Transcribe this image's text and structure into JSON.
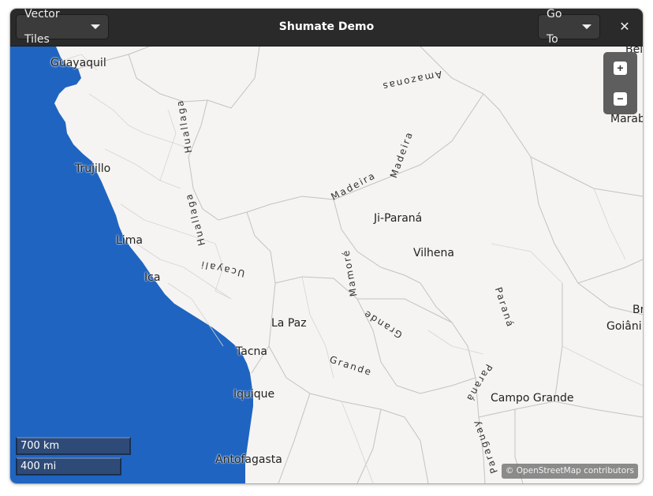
{
  "headerbar": {
    "title": "Shumate Demo",
    "layer_button": "Vector Tiles",
    "goto_button": "Go To",
    "close_glyph": "✕"
  },
  "map": {
    "cities": [
      {
        "id": "guayaquil",
        "name": "Guayaquil"
      },
      {
        "id": "trujillo",
        "name": "Trujillo"
      },
      {
        "id": "lima",
        "name": "Lima"
      },
      {
        "id": "ica",
        "name": "Ica"
      },
      {
        "id": "la-paz",
        "name": "La Paz"
      },
      {
        "id": "tacna",
        "name": "Tacna"
      },
      {
        "id": "iquique",
        "name": "Iquique"
      },
      {
        "id": "antofagasta",
        "name": "Antofagasta"
      },
      {
        "id": "ji-parana",
        "name": "Ji-Paraná"
      },
      {
        "id": "vilhena",
        "name": "Vilhena"
      },
      {
        "id": "campo-grande",
        "name": "Campo Grande"
      },
      {
        "id": "goiania",
        "name": "Goiâni"
      },
      {
        "id": "maraba",
        "name": "Marab"
      },
      {
        "id": "bel",
        "name": "Bel"
      },
      {
        "id": "br",
        "name": "Br"
      }
    ],
    "rivers": [
      {
        "id": "amazonas",
        "name": "Amazonas"
      },
      {
        "id": "madeira-1",
        "name": "Madeira"
      },
      {
        "id": "madeira-2",
        "name": "Madeira"
      },
      {
        "id": "mamore",
        "name": "Mamoré"
      },
      {
        "id": "grande-1",
        "name": "Grande"
      },
      {
        "id": "grande-2",
        "name": "Grande"
      },
      {
        "id": "parana-1",
        "name": "Paraná"
      },
      {
        "id": "parana-2",
        "name": "Paraná"
      },
      {
        "id": "ucayali",
        "name": "Ucayali"
      },
      {
        "id": "huallaga-1",
        "name": "Huallaga"
      },
      {
        "id": "huallaga-2",
        "name": "Huallaga"
      },
      {
        "id": "paraguay",
        "name": "Paraguay"
      }
    ],
    "zoom_in": "+",
    "zoom_out": "−",
    "scale_km": "700 km",
    "scale_mi": "400 mi",
    "attribution": "© OpenStreetMap contributors",
    "colors": {
      "ocean": "#1f64c0",
      "land": "#f5f4f2",
      "borders": "#c4c2bf"
    }
  }
}
